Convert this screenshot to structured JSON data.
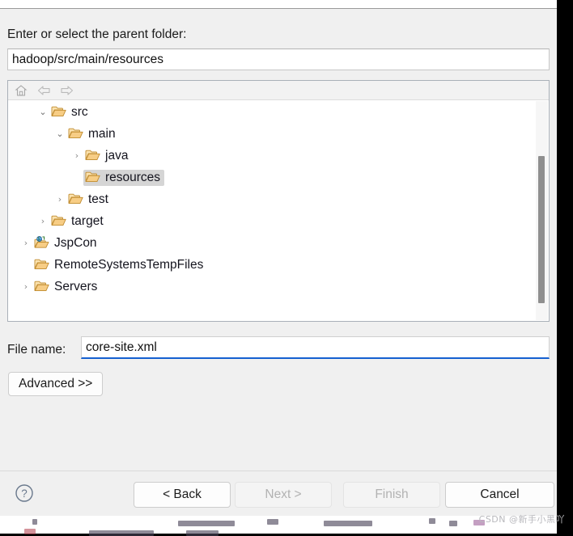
{
  "dialog": {
    "parent_folder_label": "Enter or select the parent folder:",
    "parent_folder_value": "hadoop/src/main/resources",
    "file_name_label": "File name:",
    "file_name_value": "core-site.xml",
    "advanced_label": "Advanced >>"
  },
  "tree_toolbar": {
    "home_icon": "home-icon",
    "back_icon": "back-arrow-icon",
    "forward_icon": "forward-arrow-icon"
  },
  "tree": {
    "items": [
      {
        "label": "src",
        "indent": 1,
        "twisty": "open",
        "icon": "folder-icon",
        "selected": false
      },
      {
        "label": "main",
        "indent": 2,
        "twisty": "open",
        "icon": "folder-icon",
        "selected": false
      },
      {
        "label": "java",
        "indent": 3,
        "twisty": "closed",
        "icon": "folder-icon",
        "selected": false
      },
      {
        "label": "resources",
        "indent": 3,
        "twisty": "none",
        "icon": "folder-icon",
        "selected": true
      },
      {
        "label": "test",
        "indent": 2,
        "twisty": "closed",
        "icon": "folder-icon",
        "selected": false
      },
      {
        "label": "target",
        "indent": 1,
        "twisty": "closed",
        "icon": "folder-icon",
        "selected": false
      },
      {
        "label": "JspCon",
        "indent": 0,
        "twisty": "closed",
        "icon": "web-project-icon",
        "selected": false
      },
      {
        "label": "RemoteSystemsTempFiles",
        "indent": 0,
        "twisty": "none",
        "icon": "folder-icon",
        "selected": false
      },
      {
        "label": "Servers",
        "indent": 0,
        "twisty": "closed",
        "icon": "folder-icon",
        "selected": false
      }
    ]
  },
  "buttons": {
    "help": "?",
    "back": "< Back",
    "next": "Next >",
    "finish": "Finish",
    "cancel": "Cancel"
  },
  "watermark": "CSDN @新手小黑吖",
  "colors": {
    "dialog_background": "#f0f0f0",
    "field_background": "#ffffff",
    "focus_underline": "#1560d0",
    "selection_background": "#d5d5d5",
    "folder_icon": "#f3c172",
    "disabled_text": "#b2b2b2"
  }
}
